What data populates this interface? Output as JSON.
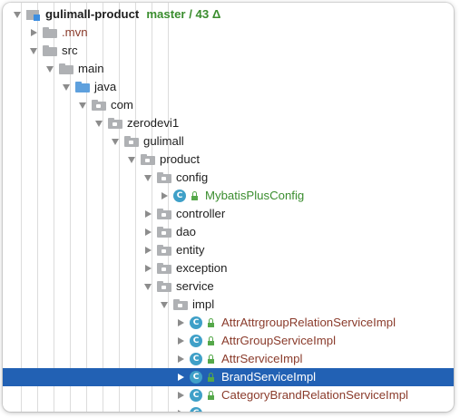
{
  "project": {
    "root_name": "gulimall-product",
    "vcs_status": "master / 43 Δ"
  },
  "tree": {
    "mvn": ".mvn",
    "src": "src",
    "main": "main",
    "java": "java",
    "com": "com",
    "zerodevi1": "zerodevi1",
    "gulimall": "gulimall",
    "product": "product",
    "config": "config",
    "mybatis_plus_config": "MybatisPlusConfig",
    "controller": "controller",
    "dao": "dao",
    "entity": "entity",
    "exception": "exception",
    "service": "service",
    "impl": "impl",
    "attr_attrgroup_relation": "AttrAttrgroupRelationServiceImpl",
    "attr_group_service": "AttrGroupServiceImpl",
    "attr_service": "AttrServiceImpl",
    "brand_service": "BrandServiceImpl",
    "category_brand_relation": "CategoryBrandRelationServiceImpl"
  },
  "icons": {
    "class_letter": "C"
  },
  "colors": {
    "selection": "#2261b4",
    "vcs_green": "#3a8d2e",
    "modified_brown": "#8a3b2b",
    "class_icon": "#3fa0c8"
  }
}
